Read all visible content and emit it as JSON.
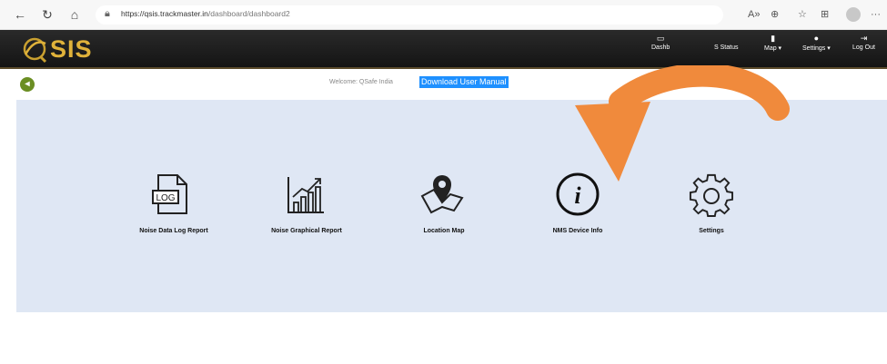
{
  "browser": {
    "url_host": "https://qsis.trackmaster.in",
    "url_path": "/dashboard/dashboard2"
  },
  "header": {
    "logo_text": "SIS",
    "nav": [
      {
        "label": "Dashb"
      },
      {
        "label": "S Status"
      },
      {
        "label": "Map ▾"
      },
      {
        "label": "Settings ▾"
      },
      {
        "label": "Log Out"
      }
    ]
  },
  "subheader": {
    "welcome": "Welcome: QSafe India",
    "manual": "Download User Manual"
  },
  "tiles": [
    {
      "label": "Noise Data Log Report",
      "icon": "log-file-icon"
    },
    {
      "label": "Noise Graphical Report",
      "icon": "bar-chart-icon"
    },
    {
      "label": "Location Map",
      "icon": "map-pin-icon"
    },
    {
      "label": "NMS Device Info",
      "icon": "info-icon"
    },
    {
      "label": "Settings",
      "icon": "gear-icon"
    }
  ],
  "colors": {
    "accent": "#e0b23a",
    "panel": "#dfe7f4",
    "arrow": "#f08a3c",
    "link_bg": "#1e90ff"
  }
}
